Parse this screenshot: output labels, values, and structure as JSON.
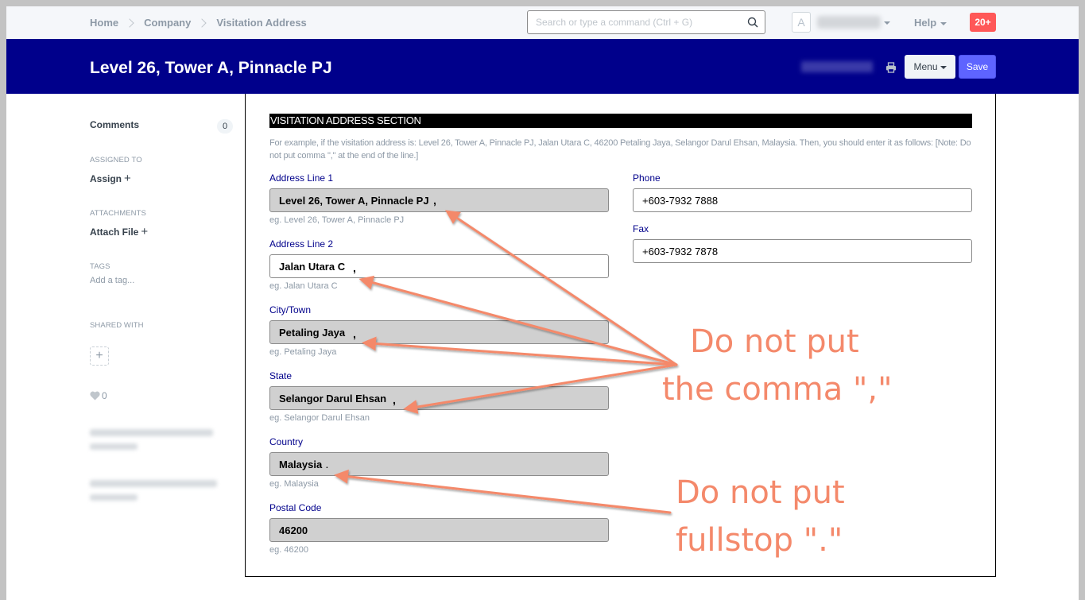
{
  "topbar": {
    "breadcrumbs": [
      "Home",
      "Company",
      "Visitation Address"
    ],
    "search_placeholder": "Search or type a command (Ctrl + G)",
    "avatar_initial": "A",
    "help_label": "Help",
    "notifications_badge": "20+"
  },
  "header": {
    "title": "Level 26, Tower A, Pinnacle PJ",
    "menu_label": "Menu",
    "save_label": "Save"
  },
  "sidebar": {
    "comments_label": "Comments",
    "comments_count": "0",
    "assigned_to_label": "ASSIGNED TO",
    "assign_label": "Assign",
    "attachments_label": "ATTACHMENTS",
    "attach_file_label": "Attach File",
    "tags_label": "TAGS",
    "add_tag_label": "Add a tag...",
    "shared_with_label": "SHARED WITH",
    "likes_count": "0"
  },
  "form": {
    "section_title": "VISITATION ADDRESS SECTION",
    "section_description": "For example, if the visitation address is: Level 26, Tower A, Pinnacle PJ, Jalan Utara C, 46200 Petaling Jaya, Selangor Darul Ehsan, Malaysia. Then, you should enter it as follows: [Note: Do not put comma \",\" at the end of the line.]",
    "fields": {
      "address_line_1": {
        "label": "Address Line 1",
        "value": "Level 26, Tower A, Pinnacle PJ",
        "help": "eg. Level 26, Tower A, Pinnacle PJ"
      },
      "address_line_2": {
        "label": "Address Line 2",
        "value": "Jalan Utara C",
        "help": "eg. Jalan Utara C"
      },
      "city": {
        "label": "City/Town",
        "value": "Petaling Jaya",
        "help": "eg. Petaling Jaya"
      },
      "state": {
        "label": "State",
        "value": "Selangor Darul Ehsan",
        "help": "eg. Selangor Darul Ehsan"
      },
      "country": {
        "label": "Country",
        "value": "Malaysia",
        "help": "eg. Malaysia"
      },
      "postal_code": {
        "label": "Postal Code",
        "value": "46200",
        "help": "eg. 46200"
      },
      "phone": {
        "label": "Phone",
        "value": "+603-7932 7888"
      },
      "fax": {
        "label": "Fax",
        "value": "+603-7932 7878"
      }
    }
  },
  "annotations": {
    "comma_note_line1": "Do not put",
    "comma_note_line2": "the comma \",\"",
    "fullstop_note_line1": "Do not put",
    "fullstop_note_line2": "fullstop \".\"",
    "comma_mark": ",",
    "fullstop_mark": ".",
    "color": "#f4896b"
  }
}
